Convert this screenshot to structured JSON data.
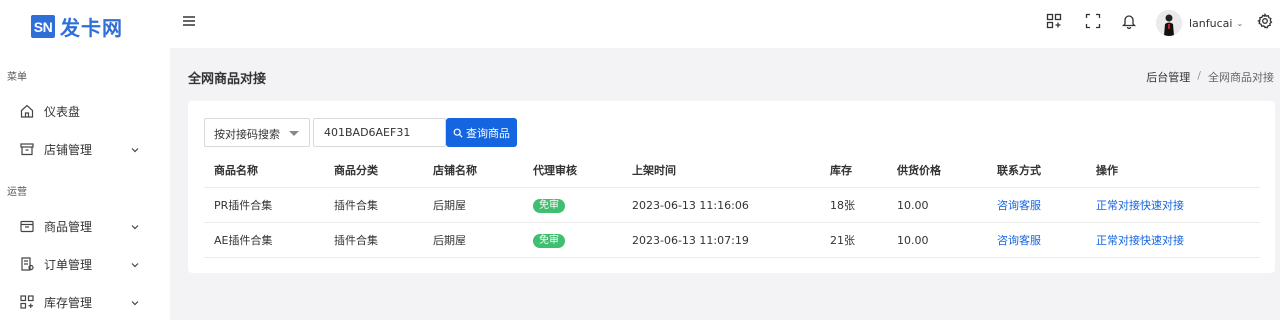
{
  "brand": {
    "badge": "SN",
    "name": "发卡网",
    "color": "#2f6fd8"
  },
  "header": {
    "icons": [
      "hamburger-icon",
      "app-grid-icon",
      "fullscreen-icon",
      "bell-icon",
      "settings-gear-icon"
    ],
    "user": {
      "name": "lanfucai",
      "caret": "⌄"
    }
  },
  "sidebar": {
    "groups": [
      {
        "title": "菜单",
        "items": [
          {
            "label": "仪表盘",
            "icon": "home-icon",
            "has_children": false
          },
          {
            "label": "店铺管理",
            "icon": "store-icon",
            "has_children": true
          }
        ]
      },
      {
        "title": "运营",
        "items": [
          {
            "label": "商品管理",
            "icon": "product-box-icon",
            "has_children": true
          },
          {
            "label": "订单管理",
            "icon": "order-icon",
            "has_children": true
          },
          {
            "label": "库存管理",
            "icon": "inventory-grid-icon",
            "has_children": true
          }
        ]
      }
    ]
  },
  "page": {
    "title": "全网商品对接",
    "breadcrumb": [
      "后台管理",
      "全网商品对接"
    ],
    "breadcrumb_sep": "/"
  },
  "search": {
    "mode_select": "按对接码搜索",
    "input_value": "401BAD6AEF31",
    "button_label": "查询商品"
  },
  "table": {
    "columns": [
      "商品名称",
      "商品分类",
      "店铺名称",
      "代理审核",
      "上架时间",
      "库存",
      "供货价格",
      "联系方式",
      "操作"
    ],
    "rows": [
      {
        "name": "PR插件合集",
        "category": "插件合集",
        "shop": "后期屋",
        "review": "免审",
        "time": "2023-06-13 11:16:06",
        "stock": "18张",
        "price": "10.00",
        "contact": "咨询客服",
        "action_normal": "正常对接",
        "action_fast": "快速对接"
      },
      {
        "name": "AE插件合集",
        "category": "插件合集",
        "shop": "后期屋",
        "review": "免审",
        "time": "2023-06-13 11:07:19",
        "stock": "21张",
        "price": "10.00",
        "contact": "咨询客服",
        "action_normal": "正常对接",
        "action_fast": "快速对接"
      }
    ]
  },
  "colors": {
    "primary": "#1565e0",
    "badge_green": "#3fbf6f",
    "background": "#f3f3f5"
  }
}
